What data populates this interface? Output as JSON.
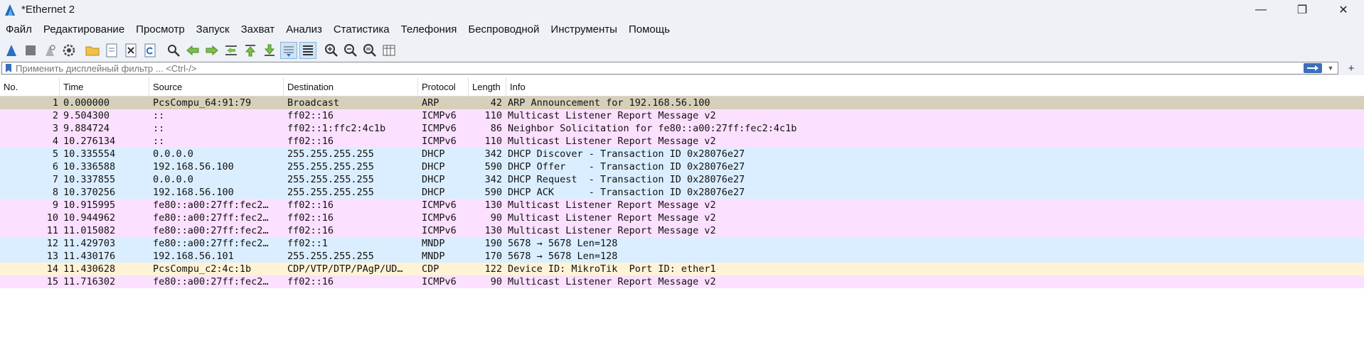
{
  "window": {
    "title": "*Ethernet 2",
    "controls": [
      "—",
      "❐",
      "✕"
    ]
  },
  "menu": [
    "Файл",
    "Редактирование",
    "Просмотр",
    "Запуск",
    "Захват",
    "Анализ",
    "Статистика",
    "Телефония",
    "Беспроводной",
    "Инструменты",
    "Помощь"
  ],
  "toolbar": {
    "icons": [
      "shark-fin-start-icon",
      "stop-icon",
      "restart-icon",
      "options-gear-icon",
      "open-folder-icon",
      "save-file-icon",
      "close-file-icon",
      "reload-icon",
      "find-icon",
      "go-back-icon",
      "go-forward-icon",
      "go-to-packet-icon",
      "first-packet-icon",
      "last-packet-icon",
      "autoscroll-icon",
      "colorize-icon",
      "zoom-in-icon",
      "zoom-out-icon",
      "normal-size-icon",
      "resize-columns-icon"
    ]
  },
  "filter": {
    "placeholder": "Применить дисплейный фильтр ... <Ctrl-/>",
    "value": ""
  },
  "columns": {
    "no": "No.",
    "time": "Time",
    "source": "Source",
    "destination": "Destination",
    "protocol": "Protocol",
    "length": "Length",
    "info": "Info"
  },
  "colors": {
    "arp": "#d6cfb9",
    "icmpv6": "#fce0ff",
    "dhcp": "#daeeff",
    "mndp": "#daeeff",
    "cdp": "#fff3d6",
    "ui_bg": "#eef1f6",
    "accent": "#3d6fb8"
  },
  "packets": [
    {
      "no": "1",
      "time": "0.000000",
      "source": "PcsCompu_64:91:79",
      "destination": "Broadcast",
      "protocol": "ARP",
      "length": "42",
      "info": "ARP Announcement for 192.168.56.100",
      "color": "#d6cfb9"
    },
    {
      "no": "2",
      "time": "9.504300",
      "source": "::",
      "destination": "ff02::16",
      "protocol": "ICMPv6",
      "length": "110",
      "info": "Multicast Listener Report Message v2",
      "color": "#fce0ff"
    },
    {
      "no": "3",
      "time": "9.884724",
      "source": "::",
      "destination": "ff02::1:ffc2:4c1b",
      "protocol": "ICMPv6",
      "length": "86",
      "info": "Neighbor Solicitation for fe80::a00:27ff:fec2:4c1b",
      "color": "#fce0ff"
    },
    {
      "no": "4",
      "time": "10.276134",
      "source": "::",
      "destination": "ff02::16",
      "protocol": "ICMPv6",
      "length": "110",
      "info": "Multicast Listener Report Message v2",
      "color": "#fce0ff"
    },
    {
      "no": "5",
      "time": "10.335554",
      "source": "0.0.0.0",
      "destination": "255.255.255.255",
      "protocol": "DHCP",
      "length": "342",
      "info": "DHCP Discover - Transaction ID 0x28076e27",
      "color": "#daeeff"
    },
    {
      "no": "6",
      "time": "10.336588",
      "source": "192.168.56.100",
      "destination": "255.255.255.255",
      "protocol": "DHCP",
      "length": "590",
      "info": "DHCP Offer    - Transaction ID 0x28076e27",
      "color": "#daeeff"
    },
    {
      "no": "7",
      "time": "10.337855",
      "source": "0.0.0.0",
      "destination": "255.255.255.255",
      "protocol": "DHCP",
      "length": "342",
      "info": "DHCP Request  - Transaction ID 0x28076e27",
      "color": "#daeeff"
    },
    {
      "no": "8",
      "time": "10.370256",
      "source": "192.168.56.100",
      "destination": "255.255.255.255",
      "protocol": "DHCP",
      "length": "590",
      "info": "DHCP ACK      - Transaction ID 0x28076e27",
      "color": "#daeeff"
    },
    {
      "no": "9",
      "time": "10.915995",
      "source": "fe80::a00:27ff:fec2…",
      "destination": "ff02::16",
      "protocol": "ICMPv6",
      "length": "130",
      "info": "Multicast Listener Report Message v2",
      "color": "#fce0ff"
    },
    {
      "no": "10",
      "time": "10.944962",
      "source": "fe80::a00:27ff:fec2…",
      "destination": "ff02::16",
      "protocol": "ICMPv6",
      "length": "90",
      "info": "Multicast Listener Report Message v2",
      "color": "#fce0ff"
    },
    {
      "no": "11",
      "time": "11.015082",
      "source": "fe80::a00:27ff:fec2…",
      "destination": "ff02::16",
      "protocol": "ICMPv6",
      "length": "130",
      "info": "Multicast Listener Report Message v2",
      "color": "#fce0ff"
    },
    {
      "no": "12",
      "time": "11.429703",
      "source": "fe80::a00:27ff:fec2…",
      "destination": "ff02::1",
      "protocol": "MNDP",
      "length": "190",
      "info": "5678 → 5678 Len=128",
      "color": "#daeeff"
    },
    {
      "no": "13",
      "time": "11.430176",
      "source": "192.168.56.101",
      "destination": "255.255.255.255",
      "protocol": "MNDP",
      "length": "170",
      "info": "5678 → 5678 Len=128",
      "color": "#daeeff"
    },
    {
      "no": "14",
      "time": "11.430628",
      "source": "PcsCompu_c2:4c:1b",
      "destination": "CDP/VTP/DTP/PAgP/UD…",
      "protocol": "CDP",
      "length": "122",
      "info": "Device ID: MikroTik  Port ID: ether1",
      "color": "#fff3d6"
    },
    {
      "no": "15",
      "time": "11.716302",
      "source": "fe80::a00:27ff:fec2…",
      "destination": "ff02::16",
      "protocol": "ICMPv6",
      "length": "90",
      "info": "Multicast Listener Report Message v2",
      "color": "#fce0ff"
    }
  ]
}
